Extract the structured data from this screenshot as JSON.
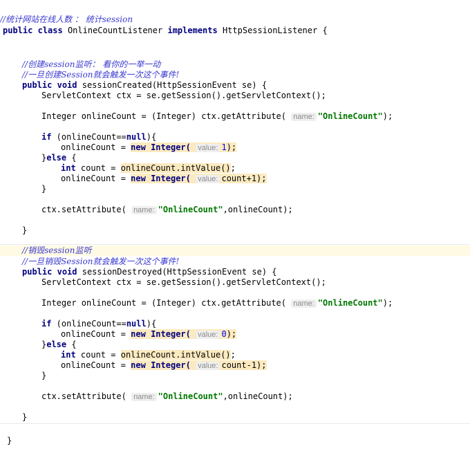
{
  "code": {
    "header_comment": "//统计网站在线人数 ： 统计session",
    "class_decl": {
      "kw_public": "public",
      "kw_class": "class",
      "name": "OnlineCountListener",
      "kw_implements": "implements",
      "iface": "HttpSessionListener",
      "brace": "{"
    },
    "comment_create_1": "//创建session监听： 看你的一举一动",
    "comment_create_2": "//一旦创建Session就会触发一次这个事件!",
    "method_created": {
      "kw_public": "public",
      "kw_void": "void",
      "signature": "sessionCreated(HttpSessionEvent se) {"
    },
    "ctx_line": "ServletContext ctx = se.getSession().getServletContext();",
    "get_attr": {
      "pre": "Integer onlineCount = (Integer) ctx.getAttribute(",
      "hint": "name:",
      "str": "\"OnlineCount\"",
      "post": ");"
    },
    "if_line": {
      "kw_if": "if",
      "pre": " (onlineCount==",
      "kw_null": "null",
      "post": "){"
    },
    "new_one": {
      "pre": "onlineCount = ",
      "kw_new": "new",
      "cls": "Integer(",
      "hint": "value:",
      "num": "1",
      "post": ");"
    },
    "else_line": {
      "pre": "}",
      "kw_else": "else",
      "post": " {"
    },
    "int_line": {
      "kw_int": "int",
      "pre": " count = ",
      "hl": "onlineCount.intValue()",
      "post": ";"
    },
    "new_plus": {
      "pre": "onlineCount = ",
      "kw_new": "new",
      "cls": "Integer(",
      "hint": "value:",
      "val": "count+1",
      "post": ");"
    },
    "close_inner": "}",
    "set_attr": {
      "pre": "ctx.setAttribute(",
      "hint": "name:",
      "str": "\"OnlineCount\"",
      "post": ",onlineCount);"
    },
    "close_method": "}",
    "comment_destroy_1": "//销毁session监听",
    "comment_destroy_2": "//一旦销毁Session就会触发一次这个事件!",
    "method_destroyed": {
      "kw_public": "public",
      "kw_void": "void",
      "signature": "sessionDestroyed(HttpSessionEvent se) {"
    },
    "new_zero": {
      "pre": "onlineCount = ",
      "kw_new": "new",
      "cls": "Integer(",
      "hint": "value:",
      "num": "0",
      "post": ");"
    },
    "new_minus": {
      "pre": "onlineCount = ",
      "kw_new": "new",
      "cls": "Integer(",
      "hint": "value:",
      "val": "count-1",
      "post": ");"
    },
    "close_class": "}"
  }
}
